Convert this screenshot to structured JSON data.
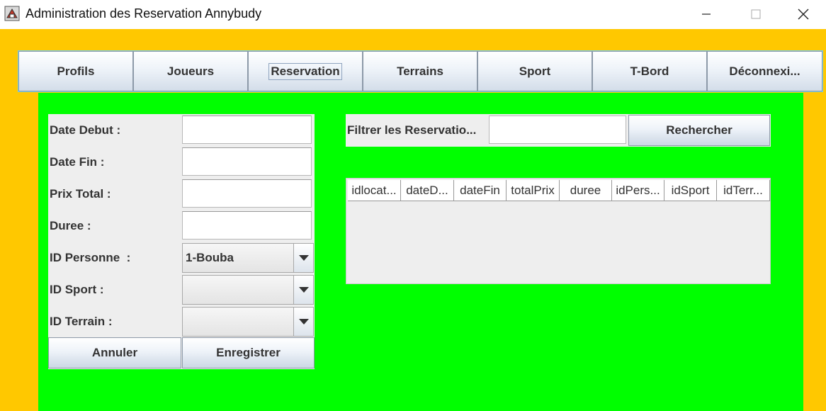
{
  "window": {
    "title": "Administration des Reservation Annybudy",
    "icon": "java-cup-icon",
    "minimize_symbol": "—",
    "maximize_symbol": "☐",
    "close_symbol": "✕"
  },
  "colors": {
    "frame": "#ffc800",
    "content": "#00ff00",
    "panel": "#eeeeee"
  },
  "tabs": [
    {
      "label": "Profils"
    },
    {
      "label": "Joueurs"
    },
    {
      "label": "Reservation",
      "selected": true
    },
    {
      "label": "Terrains"
    },
    {
      "label": "Sport"
    },
    {
      "label": "T-Bord"
    },
    {
      "label": "Déconnexi..."
    }
  ],
  "form": {
    "date_debut_label": "Date Debut :",
    "date_debut_value": "",
    "date_fin_label": "Date Fin :",
    "date_fin_value": "",
    "prix_total_label": "Prix Total :",
    "prix_total_value": "",
    "duree_label": "Duree :",
    "duree_value": "",
    "id_personne_label": "ID Personne  :",
    "id_personne_value": "1-Bouba",
    "id_sport_label": "ID Sport :",
    "id_sport_value": "",
    "id_terrain_label": "ID Terrain :",
    "id_terrain_value": "",
    "annuler_label": "Annuler",
    "enregistrer_label": "Enregistrer"
  },
  "filter": {
    "label": "Filtrer les Reservatio...",
    "value": "",
    "search_label": "Rechercher"
  },
  "table": {
    "columns": [
      "idlocat...",
      "dateD...",
      "dateFin",
      "totalPrix",
      "duree",
      "idPers...",
      "idSport",
      "idTerr..."
    ],
    "rows": []
  }
}
